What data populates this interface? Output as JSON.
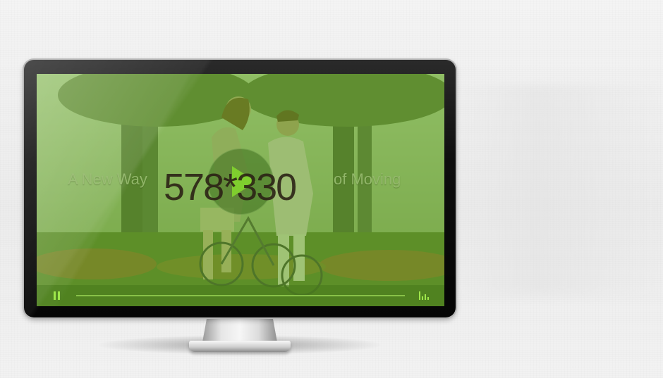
{
  "video": {
    "tagline_left": "A New Way",
    "tagline_right": "of Moving",
    "dimensions_label": "578*330",
    "progress": 0.0
  },
  "colors": {
    "overlay_green": "#68aa28",
    "control_accent": "#9ee64a",
    "play_triangle": "#7fce2e",
    "dimension_text": "#2a1f14"
  },
  "icons": {
    "play": "play-icon",
    "pause": "pause-icon",
    "volume": "volume-icon"
  }
}
